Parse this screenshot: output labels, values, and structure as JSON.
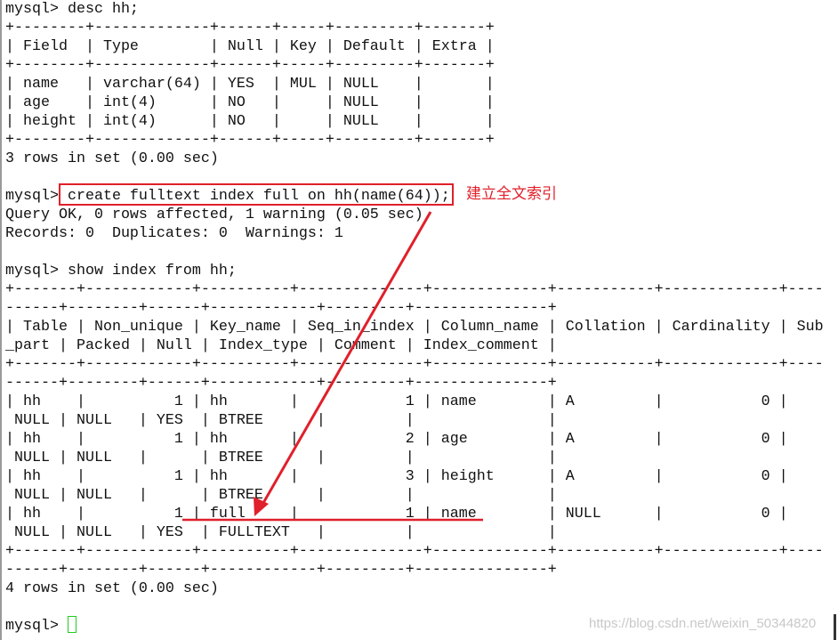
{
  "terminal": {
    "lines": [
      "mysql> desc hh;",
      "+--------+-------------+------+-----+---------+-------+",
      "| Field  | Type        | Null | Key | Default | Extra |",
      "+--------+-------------+------+-----+---------+-------+",
      "| name   | varchar(64) | YES  | MUL | NULL    |       |",
      "| age    | int(4)      | NO   |     | NULL    |       |",
      "| height | int(4)      | NO   |     | NULL    |       |",
      "+--------+-------------+------+-----+---------+-------+",
      "3 rows in set (0.00 sec)",
      "",
      "mysql> create fulltext index full on hh(name(64));",
      "Query OK, 0 rows affected, 1 warning (0.05 sec)",
      "Records: 0  Duplicates: 0  Warnings: 1",
      "",
      "mysql> show index from hh;",
      "+-------+------------+----------+--------------+-------------+-----------+-------------+----",
      "------+--------+------+------------+---------+---------------+",
      "| Table | Non_unique | Key_name | Seq_in_index | Column_name | Collation | Cardinality | Sub",
      "_part | Packed | Null | Index_type | Comment | Index_comment |",
      "+-------+------------+----------+--------------+-------------+-----------+-------------+----",
      "------+--------+------+------------+---------+---------------+",
      "| hh    |          1 | hh       |            1 | name        | A         |           0 |",
      " NULL | NULL   | YES  | BTREE      |         |               |",
      "| hh    |          1 | hh       |            2 | age         | A         |           0 |",
      " NULL | NULL   |      | BTREE      |         |               |",
      "| hh    |          1 | hh       |            3 | height      | A         |           0 |",
      " NULL | NULL   |      | BTREE      |         |               |",
      "| hh    |          1 | full     |            1 | name        | NULL      |           0 |",
      " NULL | NULL   | YES  | FULLTEXT   |         |               |",
      "+-------+------------+----------+--------------+-------------+-----------+-------------+----",
      "------+--------+------+------------+---------+---------------+",
      "4 rows in set (0.00 sec)",
      "",
      "mysql> "
    ]
  },
  "annotation": {
    "note": "建立全文索引",
    "color": "#e0202a"
  },
  "cursor_color": "#22cc22",
  "watermark": "https://blog.csdn.net/weixin_50344820"
}
